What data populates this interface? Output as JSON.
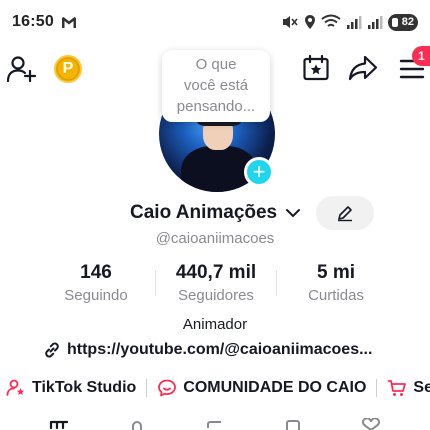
{
  "status_bar": {
    "time": "16:50",
    "battery": "82"
  },
  "top_bar": {
    "notification_count": "1",
    "coin_letter": "P"
  },
  "profile": {
    "thought_bubble": [
      "O que",
      "você está",
      "pensando..."
    ],
    "name": "Caio Animações",
    "username": "@caioaniimacoes",
    "bio": "Animador",
    "link": "https://youtube.com/@caioaniimacoes..."
  },
  "stats": [
    {
      "value": "146",
      "label": "Seguindo"
    },
    {
      "value": "440,7 mil",
      "label": "Seguidores"
    },
    {
      "value": "5 mi",
      "label": "Curtidas"
    }
  ],
  "chips": [
    {
      "label": "TikTok Studio",
      "icon": "person-star-icon"
    },
    {
      "label": "COMUNIDADE DO CAIO",
      "icon": "chat-bubble-icon"
    },
    {
      "label": "Se",
      "icon": "cart-icon"
    }
  ],
  "colors": {
    "accent_red": "#fe2c55",
    "accent_cyan": "#20d5ec",
    "coin_gold": "#f5b400",
    "text_primary": "#161823",
    "text_secondary": "#8a8b91"
  }
}
